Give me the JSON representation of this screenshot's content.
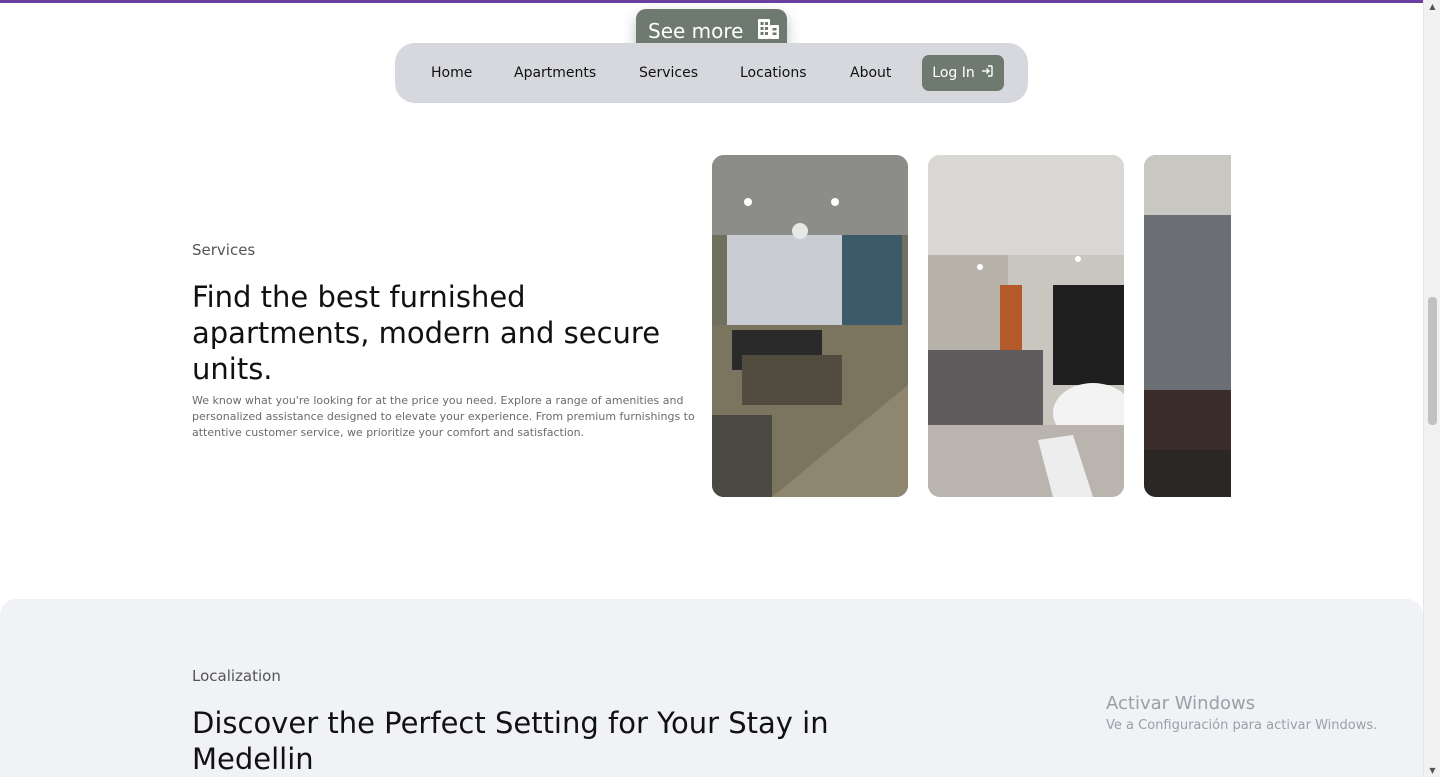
{
  "see_more": {
    "label": "See more",
    "icon": "building-icon"
  },
  "nav": {
    "items": [
      {
        "label": "Home"
      },
      {
        "label": "Apartments"
      },
      {
        "label": "Services"
      },
      {
        "label": "Locations"
      },
      {
        "label": "About"
      }
    ],
    "login_label": "Log In",
    "login_icon": "login-arrow-icon"
  },
  "services": {
    "eyebrow": "Services",
    "title": "Find the best furnished apartments, modern and secure units.",
    "body": "We know what you're looking for at the price you need. Explore a range of amenities and personalized assistance designed to elevate your experience. From premium furnishings to attentive customer service, we prioritize your comfort and satisfaction."
  },
  "localization": {
    "eyebrow": "Localization",
    "title": "Discover the Perfect Setting for Your Stay in Medellin"
  },
  "watermark": {
    "title": "Activar Windows",
    "subtitle": "Ve a Configuración para activar Windows."
  },
  "colors": {
    "accent": "#6e7a70",
    "nav_bg": "#d6d8dd",
    "top_bar": "#6a3fa0",
    "section_bg": "#f0f2f6"
  }
}
